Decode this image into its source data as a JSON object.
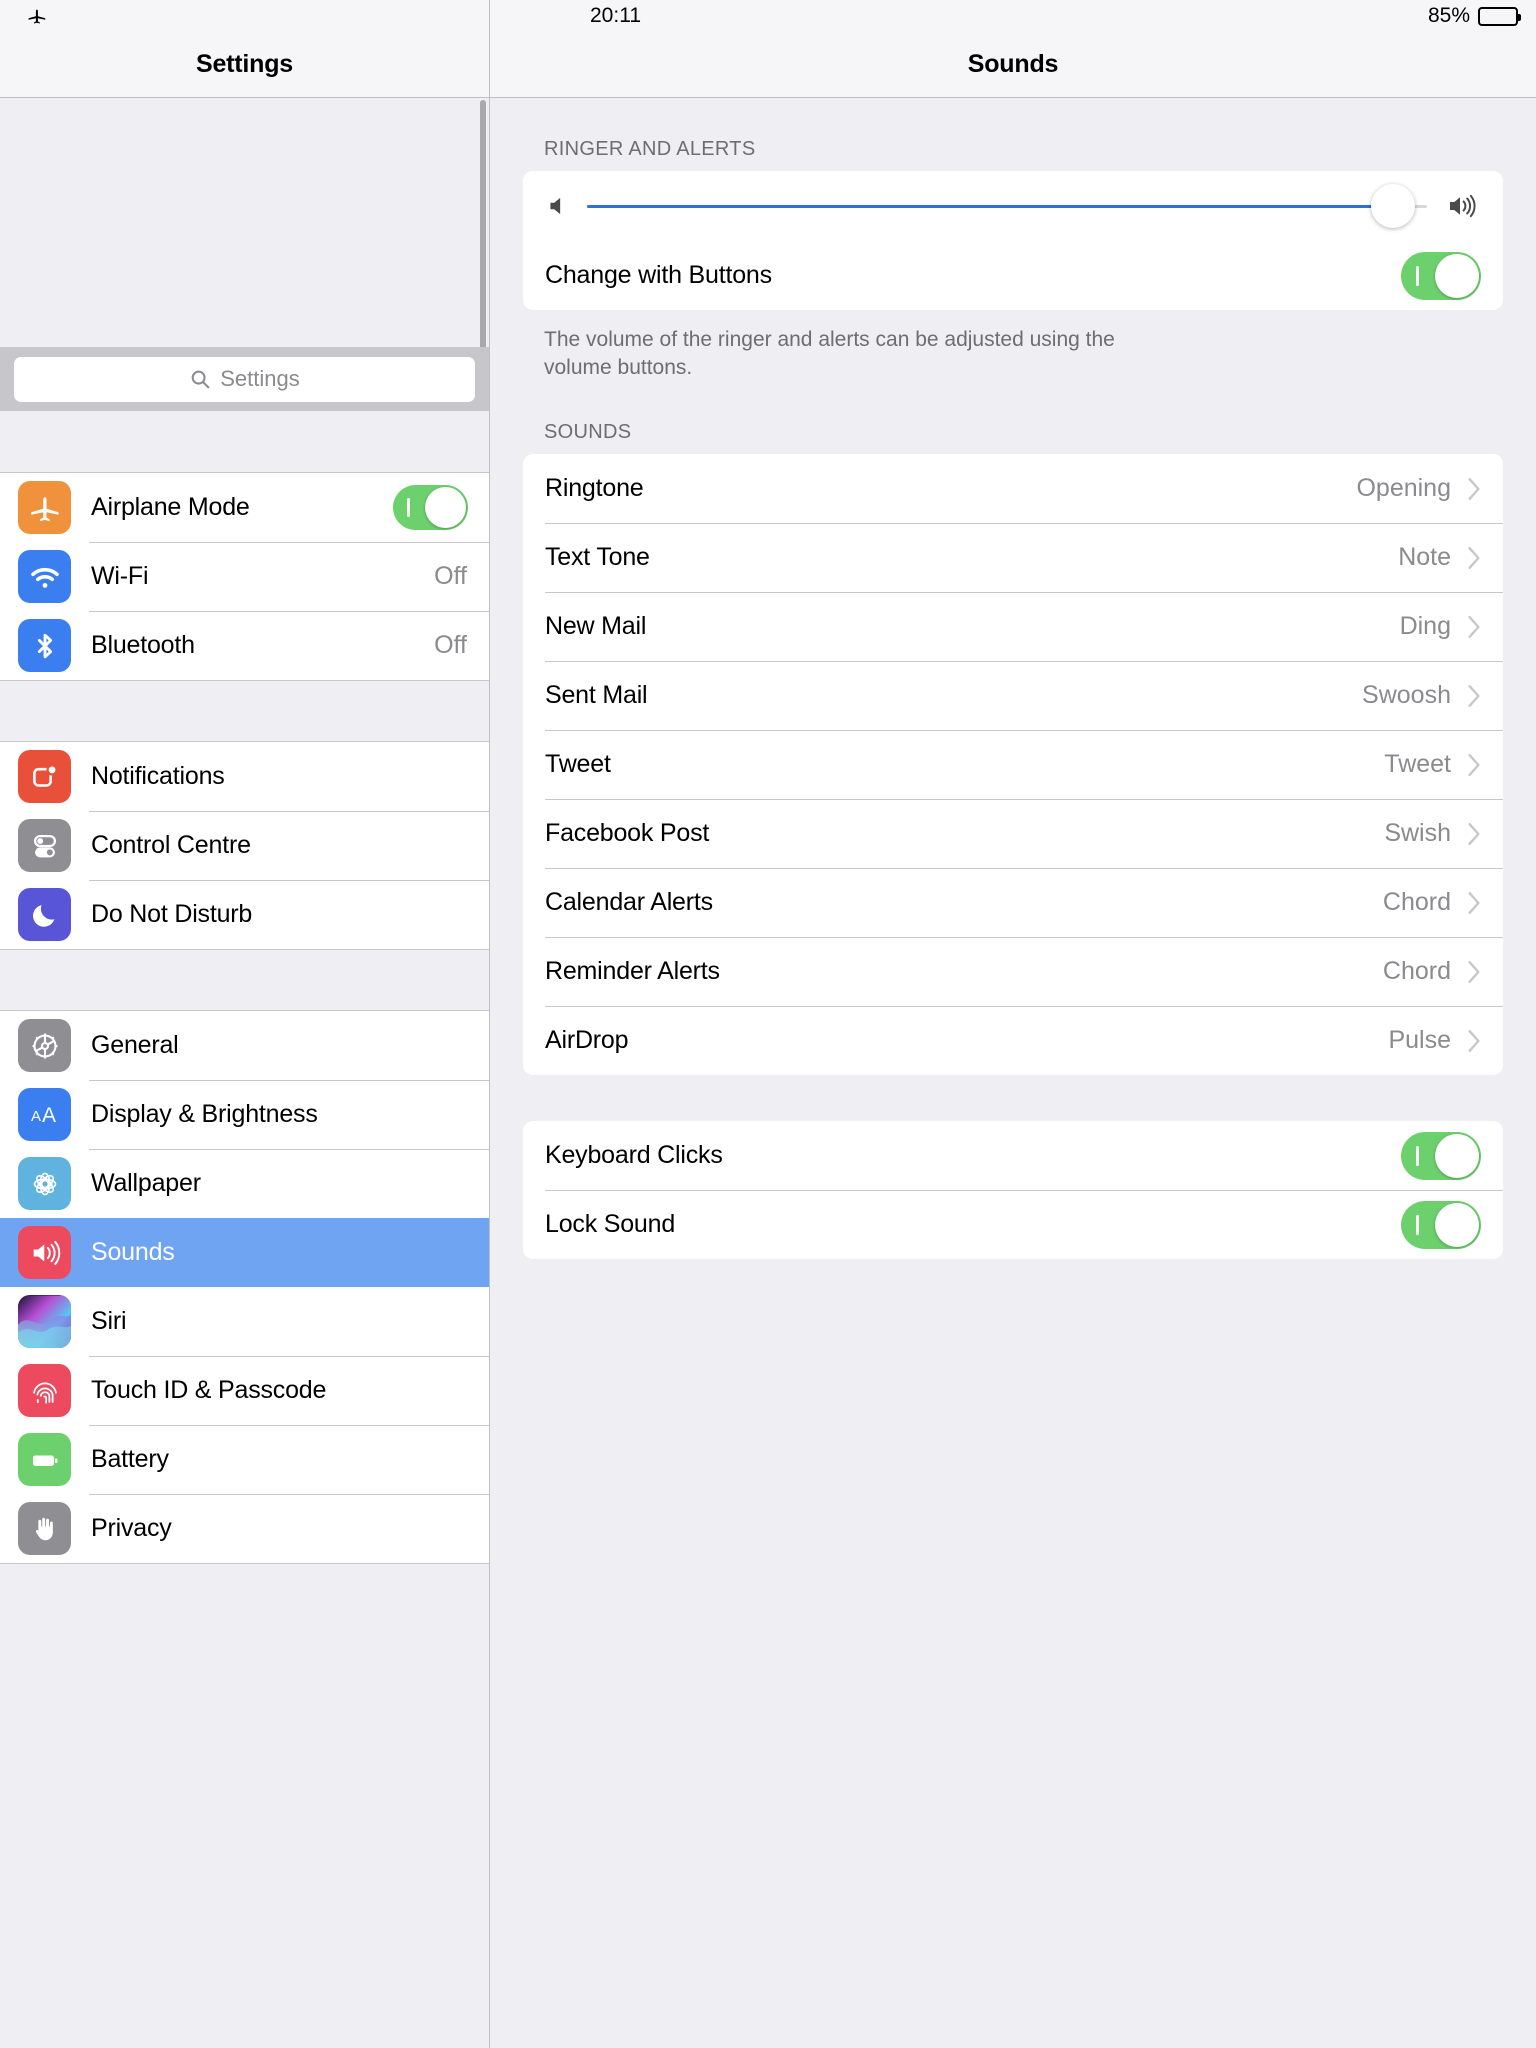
{
  "statusbar": {
    "airplane_icon": "airplane-icon",
    "time": "20:11",
    "battery_percent": "85%",
    "battery_level": 85
  },
  "sidebar": {
    "title": "Settings",
    "search": {
      "placeholder": "Settings",
      "value": "",
      "icon": "search-icon"
    },
    "groups": [
      {
        "items": [
          {
            "label": "Airplane Mode",
            "icon": "airplane-icon",
            "icon_color": "#F0923B",
            "control": "toggle",
            "toggle_on": true
          },
          {
            "label": "Wi-Fi",
            "icon": "wifi-icon",
            "icon_color": "#3A7EF0",
            "control": "value",
            "value": "Off"
          },
          {
            "label": "Bluetooth",
            "icon": "bluetooth-icon",
            "icon_color": "#3A7EF0",
            "control": "value",
            "value": "Off"
          }
        ]
      },
      {
        "items": [
          {
            "label": "Notifications",
            "icon": "notifications-icon",
            "icon_color": "#E8503A",
            "control": "none"
          },
          {
            "label": "Control Centre",
            "icon": "control-centre-icon",
            "icon_color": "#8E8E93",
            "control": "none"
          },
          {
            "label": "Do Not Disturb",
            "icon": "moon-icon",
            "icon_color": "#5856D6",
            "control": "none"
          }
        ]
      },
      {
        "items": [
          {
            "label": "General",
            "icon": "gear-icon",
            "icon_color": "#8E8E93",
            "control": "none"
          },
          {
            "label": "Display & Brightness",
            "icon": "display-brightness-icon",
            "icon_color": "#3A7EF0",
            "control": "none"
          },
          {
            "label": "Wallpaper",
            "icon": "wallpaper-icon",
            "icon_color": "#5FB3DE",
            "control": "none"
          },
          {
            "label": "Sounds",
            "icon": "sounds-icon",
            "icon_color": "#EE4A5F",
            "control": "none",
            "selected": true
          },
          {
            "label": "Siri",
            "icon": "siri-icon",
            "icon_color": "#5C3FD6",
            "control": "none"
          },
          {
            "label": "Touch ID & Passcode",
            "icon": "touch-id-icon",
            "icon_color": "#EE4A5F",
            "control": "none"
          },
          {
            "label": "Battery",
            "icon": "battery-icon",
            "icon_color": "#6CD16C",
            "control": "none"
          },
          {
            "label": "Privacy",
            "icon": "privacy-hand-icon",
            "icon_color": "#8E8E93",
            "control": "none"
          }
        ]
      }
    ],
    "selected_item": "Sounds",
    "selection_color": "#6EA4F2"
  },
  "main": {
    "title": "Sounds",
    "ringer_section": {
      "header": "RINGER AND ALERTS",
      "volume": {
        "value": 96,
        "min": 0,
        "max": 100,
        "track_color": "#2F6FD8"
      },
      "change_with_buttons": {
        "label": "Change with Buttons",
        "on": true
      },
      "footer": "The volume of the ringer and alerts can be adjusted using the volume buttons."
    },
    "sounds_section": {
      "header": "SOUNDS",
      "rows": [
        {
          "label": "Ringtone",
          "value": "Opening"
        },
        {
          "label": "Text Tone",
          "value": "Note"
        },
        {
          "label": "New Mail",
          "value": "Ding"
        },
        {
          "label": "Sent Mail",
          "value": "Swoosh"
        },
        {
          "label": "Tweet",
          "value": "Tweet"
        },
        {
          "label": "Facebook Post",
          "value": "Swish"
        },
        {
          "label": "Calendar Alerts",
          "value": "Chord"
        },
        {
          "label": "Reminder Alerts",
          "value": "Chord"
        },
        {
          "label": "AirDrop",
          "value": "Pulse"
        }
      ]
    },
    "switches_section": {
      "rows": [
        {
          "label": "Keyboard Clicks",
          "on": true
        },
        {
          "label": "Lock Sound",
          "on": true
        }
      ]
    }
  },
  "colors": {
    "toggle_on": "#6CD16C",
    "accent_blue": "#2F6FD8",
    "panel_bg": "#EFEEF3",
    "card_bg": "#FFFFFF",
    "header_text": "#6D6D72"
  }
}
